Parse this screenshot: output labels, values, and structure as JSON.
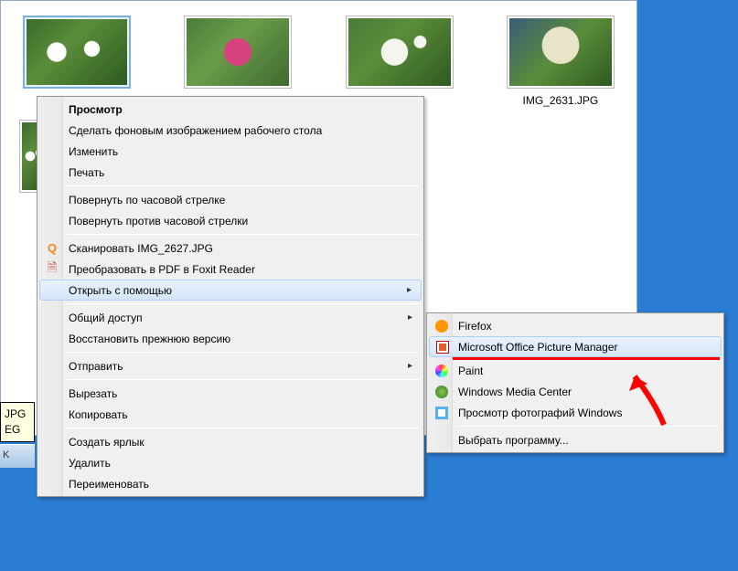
{
  "thumbnails": [
    {
      "label": ""
    },
    {
      "label": ""
    },
    {
      "label": ""
    },
    {
      "label": "IMG_2631.JPG"
    }
  ],
  "tooltip": {
    "line1": "JPG",
    "line2": "EG"
  },
  "taskbar_frag": "K",
  "context_menu": {
    "preview": "Просмотр",
    "wallpaper": "Сделать фоновым изображением рабочего стола",
    "edit": "Изменить",
    "print": "Печать",
    "rotate_cw": "Повернуть по часовой стрелке",
    "rotate_ccw": "Повернуть против часовой стрелки",
    "scan": "Сканировать IMG_2627.JPG",
    "to_pdf": "Преобразовать в PDF в Foxit Reader",
    "open_with": "Открыть с помощью",
    "share": "Общий доступ",
    "restore": "Восстановить прежнюю версию",
    "send_to": "Отправить",
    "cut": "Вырезать",
    "copy": "Копировать",
    "shortcut": "Создать ярлык",
    "delete": "Удалить",
    "rename": "Переименовать"
  },
  "submenu": {
    "firefox": "Firefox",
    "mspm": "Microsoft Office Picture Manager",
    "paint": "Paint",
    "wmc": "Windows Media Center",
    "winphoto": "Просмотр фотографий Windows",
    "choose": "Выбрать программу..."
  }
}
